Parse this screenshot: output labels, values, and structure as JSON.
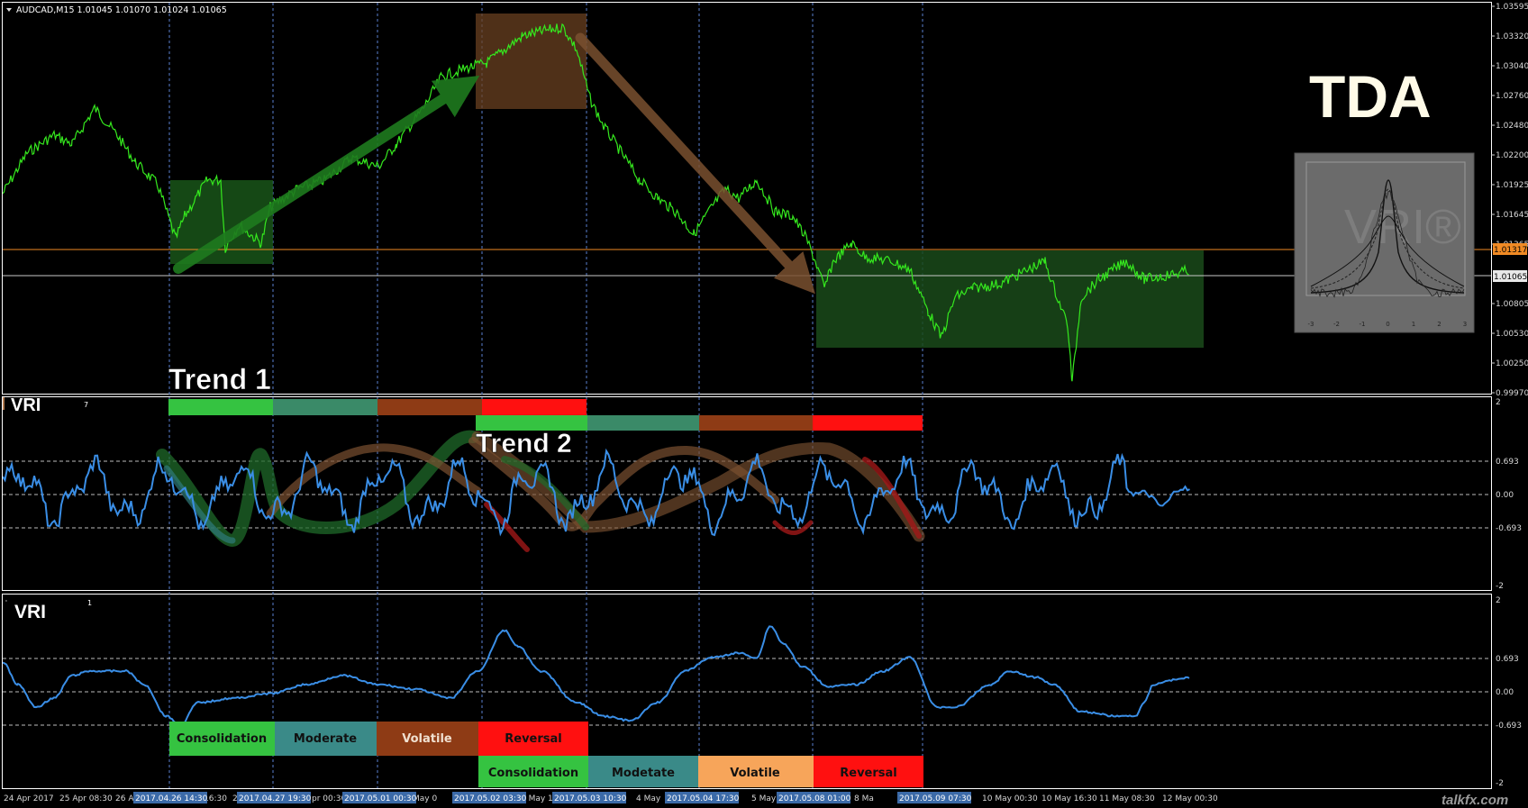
{
  "window": {
    "symbol_header": "AUDCAD,M15  1.01045 1.01070 1.01024 1.01065",
    "price_tag_orange": "1.01317",
    "price_tag_white": "1.01065"
  },
  "overlay": {
    "brand": "TDA",
    "trend1": "Trend 1",
    "trend2": "Trend 2",
    "vri_watermark": "VRI®",
    "curve_axis_ticks": [
      "-3",
      "-2",
      "-1",
      "0",
      "1",
      "2",
      "3"
    ]
  },
  "indicator1": {
    "label": "VRI",
    "param": "7",
    "levels": [
      "2",
      "0.693",
      "0.00",
      "-0.693",
      "-2"
    ]
  },
  "indicator2": {
    "label": "VRI",
    "param": "1",
    "levels": [
      "2",
      "0.693",
      "0.00",
      "-0.693",
      "-2"
    ]
  },
  "colors": {
    "price": "#35e81e",
    "vri": "#3a8ee6",
    "consolidation": "#35c341",
    "moderate": "#3a8a88",
    "volatile1": "#8e3b15",
    "reversal": "#ff1010",
    "volatile2": "#f7a55a",
    "orange_line": "#f08a24"
  },
  "stages_row1": [
    "Consolidation",
    "Moderate",
    "Volatile",
    "Reversal"
  ],
  "stages_row2": [
    "Consolidation",
    "Modetate",
    "Volatile",
    "Reversal"
  ],
  "time_axis": {
    "labels": [
      "24 Apr 2017",
      "25 Apr 08:30",
      "26 A",
      "16:30",
      "2",
      "pr 00:30",
      "May 0",
      "2 May 1",
      "4 May",
      "5 May",
      "8 Ma",
      "03:30",
      "10 May 00:30",
      "10 May 16:30",
      "11 May 08:30",
      "12 May 00:30"
    ],
    "highlights": [
      "2017.04.26 14:30",
      "2017.04.27 19:30",
      "2017.05.01 00:30",
      "2017.05.02 03:30",
      "2017.05.03 10:30",
      "2017.05.04 17:30",
      "2017.05.08 01:00",
      "2017.05.09 07:30"
    ]
  },
  "price_axis": [
    "1.03595",
    "1.03320",
    "1.03040",
    "1.02760",
    "1.02480",
    "1.02200",
    "1.01925",
    "1.01645",
    "1.01365",
    "1.00805",
    "1.00530",
    "1.00250",
    "0.99970"
  ],
  "watermark": "talkfx.com"
}
